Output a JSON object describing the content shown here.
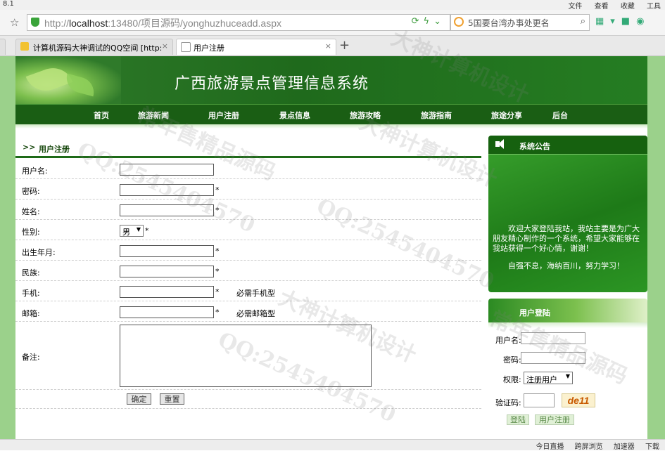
{
  "browser": {
    "version": "8.1",
    "menus": [
      "文件",
      "查看",
      "收藏",
      "工具"
    ],
    "url_scheme": "http://",
    "url_host": "localhost",
    "url_path": ":13480/项目源码/yonghuzhuceadd.aspx",
    "search_placeholder": "5国要台湾办事处更名",
    "tabs": [
      {
        "label": "计算机源码大神调试的QQ空间 [http:",
        "active": false
      },
      {
        "label": "用户注册",
        "active": true
      }
    ],
    "new_tab": "+",
    "close": "×"
  },
  "site": {
    "title": "广西旅游景点管理信息系统",
    "nav": [
      "首页",
      "旅游新闻",
      "用户注册",
      "景点信息",
      "旅游攻略",
      "旅游指南",
      "旅途分享",
      "后台"
    ]
  },
  "form": {
    "title": "用户注册",
    "title_arrows": ">>",
    "fields": {
      "username": "用户名:",
      "password": "密码:",
      "name": "姓名:",
      "gender": "性别:",
      "birth": "出生年月:",
      "ethnicity": "民族:",
      "phone": "手机:",
      "email": "邮箱:",
      "remark": "备注:"
    },
    "gender_value": "男",
    "required_mark": "*",
    "phone_hint": "必需手机型",
    "email_hint": "必需邮箱型",
    "submit": "确定",
    "reset": "重置"
  },
  "notice": {
    "title": "系统公告",
    "body": "欢迎大家登陆我站，我站主要是为广大朋友精心制作的一个系统，希望大家能够在我站获得一个好心情，谢谢！",
    "motto": "自强不息，海纳百川，努力学习！"
  },
  "login": {
    "title": "用户登陆",
    "username_label": "用户名:",
    "password_label": "密码:",
    "role_label": "权限:",
    "role_value": "注册用户",
    "captcha_label": "验证码:",
    "captcha_code": "de11",
    "login_button": "登陆",
    "register_button": "用户注册"
  },
  "statusbar": [
    "今日直播",
    "跨屏浏览",
    "加速器",
    "下载"
  ],
  "watermarks": [
    "QQ:2545404570",
    "大神计算机设计",
    "常年售精品源码",
    "QQ:2545404570",
    "大神计算机设计",
    "常年售精品源码",
    "QQ:2545404570",
    "大神计算机设计"
  ],
  "colors": {
    "header_green": "#1f6a1c",
    "nav_green": "#1a5e14",
    "page_bg": "#9bd18b",
    "captcha": "#c85a00"
  }
}
